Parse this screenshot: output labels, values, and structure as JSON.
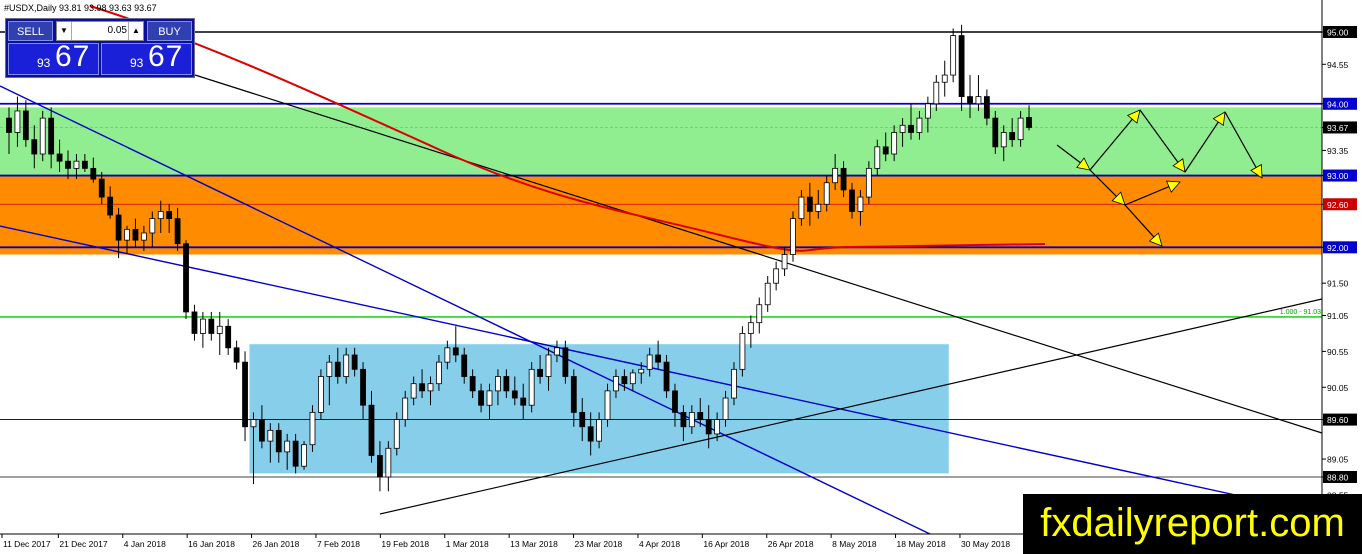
{
  "header": {
    "title": "#USDX,Daily  93.81 93.98 93.63 93.67"
  },
  "trade_panel": {
    "sell_label": "SELL",
    "buy_label": "BUY",
    "lot_value": "0.05",
    "sell_small": "93",
    "sell_big": "67",
    "buy_small": "93",
    "buy_big": "67"
  },
  "watermark": "fxdailyreport.com",
  "colors": {
    "green_zone": "#90ee90",
    "orange_zone": "#ff8c00",
    "blue_box": "#87ceeb",
    "level_line": "#0000cc",
    "moving_average": "#dd0000",
    "trendline": "#000000",
    "arrow": "#ffff00"
  },
  "chart_data": {
    "type": "candlestick",
    "symbol": "#USDX",
    "timeframe": "Daily",
    "ohlc_last": {
      "open": 93.81,
      "high": 93.98,
      "low": 93.63,
      "close": 93.67
    },
    "ylim": [
      88.45,
      95.2
    ],
    "y_ticks": [
      {
        "value": 95.0,
        "label": "95.00",
        "highlight": true
      },
      {
        "value": 94.55,
        "label": "94.55"
      },
      {
        "value": 94.0,
        "label": "94.00",
        "highlight": true
      },
      {
        "value": 93.67,
        "label": "93.67",
        "highlight": true
      },
      {
        "value": 93.35,
        "label": "93.35"
      },
      {
        "value": 93.0,
        "label": "93.00",
        "highlight": true
      },
      {
        "value": 92.6,
        "label": "92.60",
        "highlight": true,
        "color": "#cc0000"
      },
      {
        "value": 92.0,
        "label": "92.00",
        "highlight": true
      },
      {
        "value": 91.5,
        "label": "91.50"
      },
      {
        "value": 91.05,
        "label": "91.05"
      },
      {
        "value": 90.55,
        "label": "90.55"
      },
      {
        "value": 90.05,
        "label": "90.05"
      },
      {
        "value": 89.6,
        "label": "89.60",
        "highlight": true
      },
      {
        "value": 89.05,
        "label": "89.05"
      },
      {
        "value": 88.8,
        "label": "88.80",
        "highlight": true
      },
      {
        "value": 88.55,
        "label": "88.55"
      }
    ],
    "x_ticks": [
      {
        "label": "11 Dec 2017",
        "index": 0
      },
      {
        "label": "21 Dec 2017",
        "index": 7
      },
      {
        "label": "4 Jan 2018",
        "index": 15
      },
      {
        "label": "16 Jan 2018",
        "index": 23
      },
      {
        "label": "26 Jan 2018",
        "index": 31
      },
      {
        "label": "7 Feb 2018",
        "index": 39
      },
      {
        "label": "19 Feb 2018",
        "index": 47
      },
      {
        "label": "1 Mar 2018",
        "index": 55
      },
      {
        "label": "13 Mar 2018",
        "index": 63
      },
      {
        "label": "23 Mar 2018",
        "index": 71
      },
      {
        "label": "4 Apr 2018",
        "index": 79
      },
      {
        "label": "16 Apr 2018",
        "index": 87
      },
      {
        "label": "26 Apr 2018",
        "index": 95
      },
      {
        "label": "8 May 2018",
        "index": 103
      },
      {
        "label": "18 May 2018",
        "index": 111
      },
      {
        "label": "30 May 2018",
        "index": 119
      }
    ],
    "candles": [
      [
        93.8,
        93.95,
        93.3,
        93.6
      ],
      [
        93.6,
        94.1,
        93.4,
        93.9
      ],
      [
        93.9,
        94.05,
        93.4,
        93.5
      ],
      [
        93.5,
        93.7,
        93.1,
        93.3
      ],
      [
        93.3,
        93.9,
        93.2,
        93.8
      ],
      [
        93.8,
        93.95,
        93.1,
        93.3
      ],
      [
        93.3,
        93.5,
        93.05,
        93.2
      ],
      [
        93.2,
        93.35,
        92.95,
        93.1
      ],
      [
        93.1,
        93.3,
        92.95,
        93.2
      ],
      [
        93.2,
        93.3,
        93.05,
        93.1
      ],
      [
        93.1,
        93.25,
        92.9,
        92.95
      ],
      [
        92.95,
        93.05,
        92.6,
        92.7
      ],
      [
        92.7,
        92.85,
        92.4,
        92.45
      ],
      [
        92.45,
        92.55,
        91.85,
        92.1
      ],
      [
        92.1,
        92.3,
        91.9,
        92.25
      ],
      [
        92.25,
        92.4,
        92.0,
        92.1
      ],
      [
        92.1,
        92.3,
        91.95,
        92.2
      ],
      [
        92.2,
        92.5,
        92.0,
        92.4
      ],
      [
        92.4,
        92.65,
        92.2,
        92.5
      ],
      [
        92.5,
        92.6,
        92.2,
        92.4
      ],
      [
        92.4,
        92.55,
        91.95,
        92.05
      ],
      [
        92.05,
        92.1,
        91.0,
        91.1
      ],
      [
        91.1,
        91.2,
        90.7,
        90.8
      ],
      [
        90.8,
        91.1,
        90.6,
        91.0
      ],
      [
        91.0,
        91.1,
        90.7,
        90.8
      ],
      [
        90.8,
        91.1,
        90.5,
        90.9
      ],
      [
        90.9,
        91.0,
        90.5,
        90.6
      ],
      [
        90.6,
        90.7,
        90.3,
        90.4
      ],
      [
        90.4,
        90.55,
        89.3,
        89.5
      ],
      [
        89.5,
        89.7,
        88.7,
        89.6
      ],
      [
        89.6,
        89.8,
        89.2,
        89.3
      ],
      [
        89.3,
        89.55,
        89.0,
        89.45
      ],
      [
        89.45,
        89.55,
        89.0,
        89.15
      ],
      [
        89.15,
        89.4,
        88.9,
        89.3
      ],
      [
        89.3,
        89.4,
        88.85,
        88.95
      ],
      [
        88.95,
        89.3,
        88.9,
        89.25
      ],
      [
        89.25,
        89.8,
        89.15,
        89.7
      ],
      [
        89.7,
        90.3,
        89.6,
        90.2
      ],
      [
        90.2,
        90.5,
        89.8,
        90.4
      ],
      [
        90.4,
        90.6,
        90.1,
        90.2
      ],
      [
        90.2,
        90.6,
        90.1,
        90.5
      ],
      [
        90.5,
        90.6,
        90.2,
        90.3
      ],
      [
        90.3,
        90.4,
        89.6,
        89.8
      ],
      [
        89.8,
        90.0,
        89.0,
        89.1
      ],
      [
        89.1,
        89.3,
        88.6,
        88.8
      ],
      [
        88.8,
        89.3,
        88.6,
        89.2
      ],
      [
        89.2,
        89.7,
        89.1,
        89.6
      ],
      [
        89.6,
        90.0,
        89.5,
        89.9
      ],
      [
        89.9,
        90.2,
        89.8,
        90.1
      ],
      [
        90.1,
        90.3,
        89.9,
        90.0
      ],
      [
        90.0,
        90.2,
        89.8,
        90.1
      ],
      [
        90.1,
        90.5,
        90.0,
        90.4
      ],
      [
        90.4,
        90.7,
        90.3,
        90.6
      ],
      [
        90.6,
        90.9,
        90.4,
        90.5
      ],
      [
        90.5,
        90.6,
        90.1,
        90.2
      ],
      [
        90.2,
        90.3,
        89.9,
        90.0
      ],
      [
        90.0,
        90.1,
        89.7,
        89.8
      ],
      [
        89.8,
        90.1,
        89.6,
        90.0
      ],
      [
        90.0,
        90.3,
        89.8,
        90.2
      ],
      [
        90.2,
        90.3,
        89.9,
        90.0
      ],
      [
        90.0,
        90.2,
        89.8,
        89.9
      ],
      [
        89.9,
        90.1,
        89.6,
        89.8
      ],
      [
        89.8,
        90.4,
        89.7,
        90.3
      ],
      [
        90.3,
        90.5,
        90.1,
        90.2
      ],
      [
        90.2,
        90.6,
        90.0,
        90.5
      ],
      [
        90.5,
        90.7,
        90.4,
        90.6
      ],
      [
        90.6,
        90.7,
        90.1,
        90.2
      ],
      [
        90.2,
        90.3,
        89.5,
        89.7
      ],
      [
        89.7,
        89.9,
        89.3,
        89.5
      ],
      [
        89.5,
        89.7,
        89.1,
        89.3
      ],
      [
        89.3,
        89.7,
        89.2,
        89.6
      ],
      [
        89.6,
        90.1,
        89.5,
        90.0
      ],
      [
        90.0,
        90.3,
        89.9,
        90.2
      ],
      [
        90.2,
        90.3,
        90.0,
        90.1
      ],
      [
        90.1,
        90.3,
        90.0,
        90.25
      ],
      [
        90.25,
        90.4,
        90.1,
        90.3
      ],
      [
        90.3,
        90.6,
        90.2,
        90.5
      ],
      [
        90.5,
        90.7,
        90.3,
        90.4
      ],
      [
        90.4,
        90.5,
        89.9,
        90.0
      ],
      [
        90.0,
        90.1,
        89.5,
        89.7
      ],
      [
        89.7,
        89.8,
        89.3,
        89.5
      ],
      [
        89.5,
        89.8,
        89.4,
        89.7
      ],
      [
        89.7,
        89.9,
        89.5,
        89.6
      ],
      [
        89.6,
        89.8,
        89.2,
        89.4
      ],
      [
        89.4,
        89.7,
        89.3,
        89.6
      ],
      [
        89.6,
        90.0,
        89.5,
        89.9
      ],
      [
        89.9,
        90.4,
        89.8,
        90.3
      ],
      [
        90.3,
        90.9,
        90.2,
        90.8
      ],
      [
        90.8,
        91.05,
        90.6,
        90.95
      ],
      [
        90.95,
        91.3,
        90.8,
        91.2
      ],
      [
        91.2,
        91.6,
        91.1,
        91.5
      ],
      [
        91.5,
        91.8,
        91.4,
        91.7
      ],
      [
        91.7,
        92.0,
        91.6,
        91.9
      ],
      [
        91.9,
        92.5,
        91.8,
        92.4
      ],
      [
        92.4,
        92.8,
        92.3,
        92.7
      ],
      [
        92.7,
        92.9,
        92.3,
        92.5
      ],
      [
        92.5,
        92.8,
        92.4,
        92.6
      ],
      [
        92.6,
        93.0,
        92.5,
        92.9
      ],
      [
        92.9,
        93.3,
        92.8,
        93.1
      ],
      [
        93.1,
        93.2,
        92.7,
        92.8
      ],
      [
        92.8,
        92.9,
        92.4,
        92.5
      ],
      [
        92.5,
        92.8,
        92.3,
        92.7
      ],
      [
        92.7,
        93.2,
        92.6,
        93.1
      ],
      [
        93.1,
        93.5,
        93.0,
        93.4
      ],
      [
        93.4,
        93.6,
        93.2,
        93.3
      ],
      [
        93.3,
        93.7,
        93.2,
        93.6
      ],
      [
        93.6,
        93.8,
        93.4,
        93.7
      ],
      [
        93.7,
        94.0,
        93.5,
        93.6
      ],
      [
        93.6,
        93.9,
        93.5,
        93.8
      ],
      [
        93.8,
        94.1,
        93.6,
        94.0
      ],
      [
        94.0,
        94.4,
        93.9,
        94.3
      ],
      [
        94.3,
        94.6,
        94.1,
        94.4
      ],
      [
        94.4,
        95.05,
        94.3,
        94.95
      ],
      [
        94.95,
        95.1,
        93.9,
        94.1
      ],
      [
        94.1,
        94.4,
        93.8,
        94.0
      ],
      [
        94.0,
        94.4,
        93.9,
        94.1
      ],
      [
        94.1,
        94.2,
        93.7,
        93.8
      ],
      [
        93.8,
        93.9,
        93.3,
        93.4
      ],
      [
        93.4,
        93.7,
        93.2,
        93.6
      ],
      [
        93.6,
        93.8,
        93.4,
        93.5
      ],
      [
        93.5,
        93.9,
        93.4,
        93.8
      ],
      [
        93.81,
        93.98,
        93.63,
        93.67
      ]
    ],
    "zones": [
      {
        "name": "green",
        "from": 93.0,
        "to": 93.95
      },
      {
        "name": "orange",
        "from": 91.9,
        "to": 93.0
      }
    ],
    "range_box": {
      "from_index": 29,
      "to_index": 111,
      "low": 88.85,
      "high": 90.65
    },
    "horizontal_levels": [
      95.0,
      94.0,
      93.0,
      92.6,
      92.0,
      91.03,
      89.6,
      88.8
    ],
    "green_line_label": "1.000 - 91.03"
  }
}
